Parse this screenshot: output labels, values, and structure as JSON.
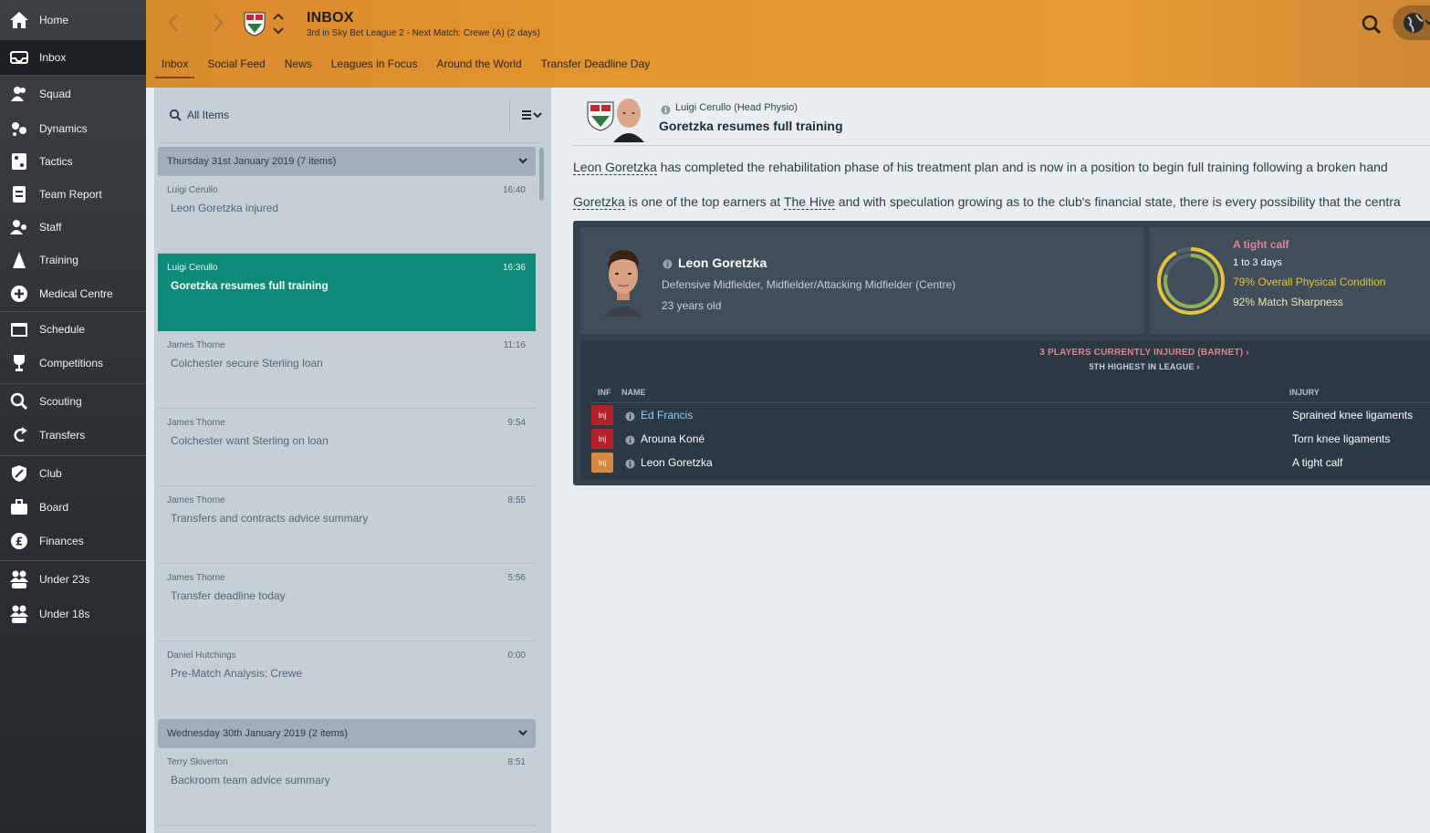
{
  "sidebar": {
    "items": [
      {
        "label": "Home",
        "icon": "home-icon"
      },
      {
        "label": "Inbox",
        "icon": "inbox-icon"
      },
      {
        "label": "Squad",
        "icon": "squad-icon"
      },
      {
        "label": "Dynamics",
        "icon": "dynamics-icon"
      },
      {
        "label": "Tactics",
        "icon": "tactics-icon"
      },
      {
        "label": "Team Report",
        "icon": "team-report-icon"
      },
      {
        "label": "Staff",
        "icon": "staff-icon"
      },
      {
        "label": "Training",
        "icon": "training-icon"
      },
      {
        "label": "Medical Centre",
        "icon": "medical-centre-icon"
      },
      {
        "label": "Schedule",
        "icon": "schedule-icon"
      },
      {
        "label": "Competitions",
        "icon": "trophy-icon"
      },
      {
        "label": "Scouting",
        "icon": "scouting-icon"
      },
      {
        "label": "Transfers",
        "icon": "transfers-icon"
      },
      {
        "label": "Club",
        "icon": "club-icon"
      },
      {
        "label": "Board",
        "icon": "board-icon"
      },
      {
        "label": "Finances",
        "icon": "finances-icon"
      },
      {
        "label": "Under 23s",
        "icon": "under-23s-icon"
      },
      {
        "label": "Under 18s",
        "icon": "under-18s-icon"
      }
    ],
    "active": "Inbox"
  },
  "header": {
    "title": "INBOX",
    "subtitle": "3rd in Sky Bet League 2 - Next Match: Crewe (A) (2 days)",
    "tabs": [
      "Inbox",
      "Social Feed",
      "News",
      "Leagues in Focus",
      "Around the World",
      "Transfer Deadline Day"
    ],
    "active_tab": "Inbox"
  },
  "list": {
    "filter_label": "All Items",
    "groups": [
      {
        "header": "Thursday 31st January 2019 (7 items)",
        "messages": [
          {
            "sender": "Luigi Cerullo",
            "time": "16:40",
            "subject": "Leon Goretzka injured"
          },
          {
            "sender": "Luigi Cerullo",
            "time": "16:36",
            "subject": "Goretzka resumes full training"
          },
          {
            "sender": "James Thorne",
            "time": "11:16",
            "subject": "Colchester secure Sterling loan"
          },
          {
            "sender": "James Thorne",
            "time": "9:54",
            "subject": "Colchester want Sterling on loan"
          },
          {
            "sender": "James Thorne",
            "time": "8:55",
            "subject": "Transfers and contracts advice summary"
          },
          {
            "sender": "James Thorne",
            "time": "5:56",
            "subject": "Transfer deadline today"
          },
          {
            "sender": "Daniel Hutchings",
            "time": "0:00",
            "subject": "Pre-Match Analysis: Crewe"
          }
        ]
      },
      {
        "header": "Wednesday 30th January 2019 (2 items)",
        "messages": [
          {
            "sender": "Terry Skiverton",
            "time": "8:51",
            "subject": "Backroom team advice summary"
          }
        ]
      }
    ],
    "selected_subject": "Goretzka resumes full training"
  },
  "message": {
    "from": "Luigi Cerullo  (Head Physio)",
    "title": "Goretzka resumes full training",
    "para1": {
      "link": "Leon Goretzka",
      "text": " has completed the rehabilitation phase of his treatment plan and is now in a position to begin full training following a broken hand"
    },
    "para2": {
      "link1": "Goretzka",
      "text1": " is one of the top earners at ",
      "link2": "The Hive",
      "text2": " and with speculation growing as to the club's financial state, there is every possibility that the centra"
    }
  },
  "player": {
    "name": "Leon Goretzka",
    "positions": "Defensive Midfielder, Midfielder/Attacking Midfielder (Centre)",
    "age": "23 years old",
    "injury": "A tight calf",
    "injury_duration": "1 to 3 days",
    "physical_condition": "79% Overall Physical Condition",
    "match_sharpness": "92% Match Sharpness",
    "physical_condition_value": 79,
    "match_sharpness_value": 92
  },
  "injuries": {
    "summary": "3 PLAYERS CURRENTLY INJURED (BARNET) ›",
    "rank": "5TH HIGHEST IN LEAGUE ›",
    "columns": {
      "inf": "INF",
      "name": "NAME",
      "injury": "INJURY"
    },
    "rows": [
      {
        "badge": "Inj",
        "name": "Ed Francis",
        "injury": "Sprained knee ligaments",
        "badge_color": "#b4232a"
      },
      {
        "badge": "Inj",
        "name": "Arouna Koné",
        "injury": "Torn knee ligaments",
        "badge_color": "#b4232a"
      },
      {
        "badge": "Inj",
        "name": "Leon Goretzka",
        "injury": "A tight calf",
        "badge_color": "#d6893f"
      }
    ]
  },
  "colors": {
    "header_orange": "#e4962e",
    "selected_teal": "#0e8a79",
    "injury_red": "#e5818c",
    "condition_yellow": "#e8c23a"
  }
}
